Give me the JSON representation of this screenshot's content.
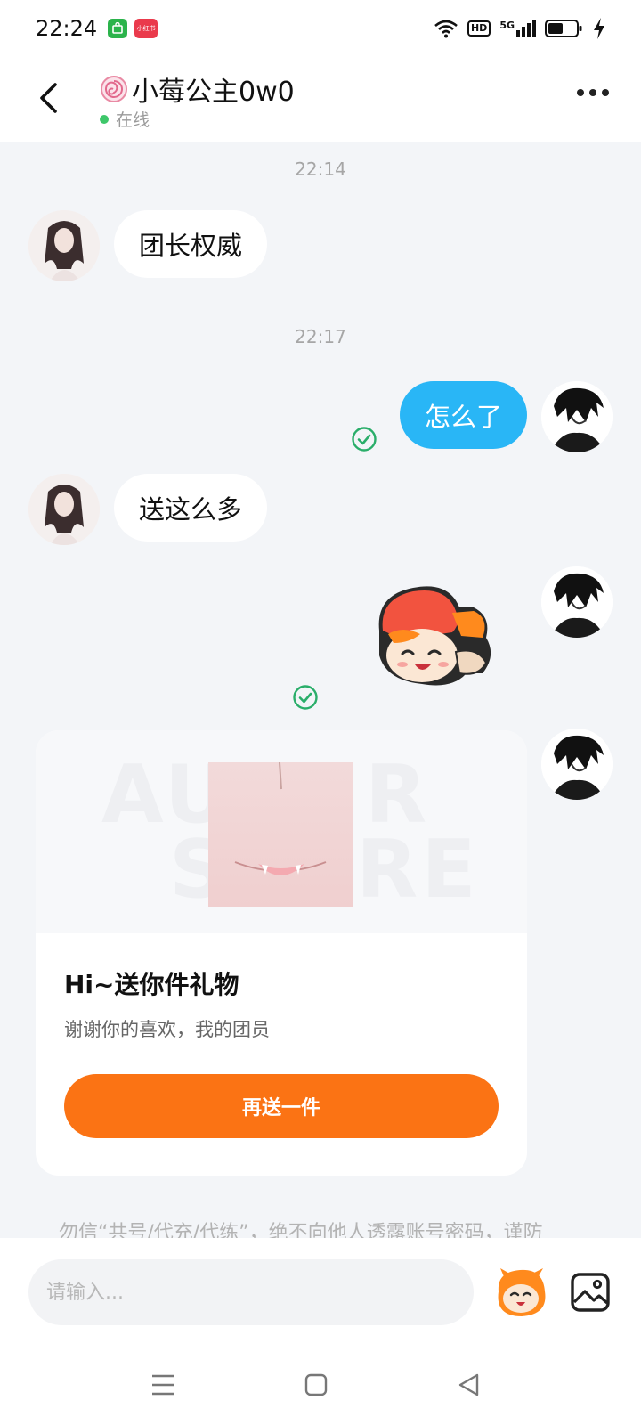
{
  "status_bar": {
    "time": "22:24",
    "app_icon_2": "小红书",
    "hd": "HD",
    "network": "5G",
    "colors": {
      "app_icon_1": "#2bb34b",
      "app_icon_2": "#ea3a4c"
    }
  },
  "header": {
    "title": "小莓公主0w0",
    "status": "在线",
    "icons": {
      "back": "back-arrow-icon",
      "name_badge": "lollipop-icon",
      "more": "more-dots-icon"
    }
  },
  "messages": [
    {
      "time": "22:14"
    },
    {
      "from": "them",
      "text": "团长权威"
    },
    {
      "time": "22:17"
    },
    {
      "from": "me",
      "text": "怎么了",
      "read": true
    },
    {
      "from": "them",
      "text": "送这么多"
    },
    {
      "from": "me",
      "type": "sticker",
      "sticker": "cartoon-sticker",
      "read": true
    },
    {
      "from": "me",
      "type": "gift-card"
    }
  ],
  "gift_card": {
    "watermark_line1": "AU",
    "watermark_line2": "R",
    "watermark_line3": "S",
    "watermark_line4": "RE",
    "title": "Hi~送你件礼物",
    "description": "谢谢你的喜欢，我的团员",
    "button": "再送一件"
  },
  "warning": "勿信“共号/代充/代练”，绝不向他人透露账号密码，谨防",
  "input": {
    "placeholder": "请输入..."
  },
  "colors": {
    "accent_blue": "#29b6f6",
    "accent_orange": "#fb7314",
    "online_green": "#3ec76a",
    "read_green": "#2aae6a"
  }
}
